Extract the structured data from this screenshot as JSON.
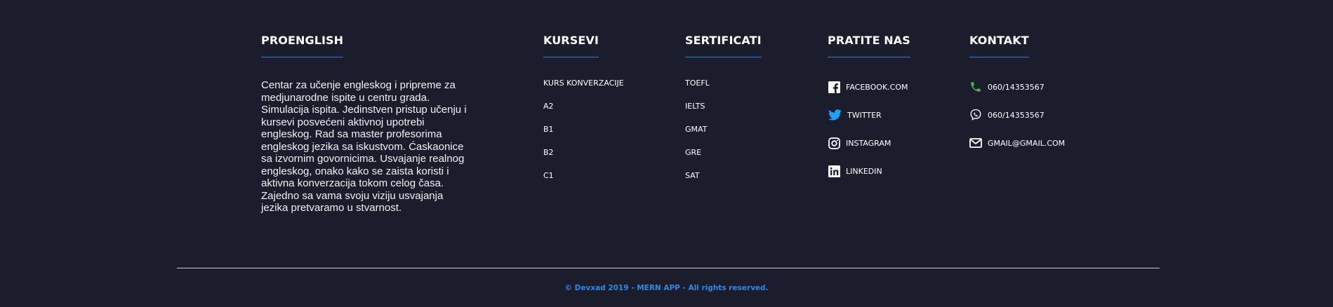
{
  "about": {
    "title": "PROENGLISH",
    "text": "Centar za učenje engleskog i pripreme za medjunarodne ispite u centru grada. Simulacija ispita. Jedinstven pristup učenju i kursevi posvećeni aktivnoj upotrebi engleskog. Rad sa master profesorima engleskog jezika sa iskustvom. Ćaskaonice sa izvornim govornicima. Usvajanje realnog engleskog, onako kako se zaista koristi i aktivna konverzacija tokom celog časa. Zajedno sa vama svoju viziju usvajanja jezika pretvaramo u stvarnost."
  },
  "courses": {
    "title": "KURSEVI",
    "items": [
      "KURS KONVERZACIJE",
      "A2",
      "B1",
      "B2",
      "C1"
    ]
  },
  "certificates": {
    "title": "SERTIFICATI",
    "items": [
      "TOEFL",
      "IELTS",
      "GMAT",
      "GRE",
      "SAT"
    ]
  },
  "follow": {
    "title": "PRATITE NAS",
    "items": [
      {
        "label": "FACEBOOK.COM",
        "icon": "facebook-icon"
      },
      {
        "label": "TWITTER",
        "icon": "twitter-icon"
      },
      {
        "label": "INSTAGRAM",
        "icon": "instagram-icon"
      },
      {
        "label": "LINKEDIN",
        "icon": "linkedin-icon"
      }
    ]
  },
  "contact": {
    "title": "KONTAKT",
    "items": [
      {
        "label": "060/14353567",
        "icon": "phone-icon"
      },
      {
        "label": "060/14353567",
        "icon": "viber-icon"
      },
      {
        "label": "GMAIL@GMAIL.COM",
        "icon": "envelope-icon"
      }
    ]
  },
  "footer": {
    "copyright": "© Devxad 2019 - MERN APP - All rights reserved."
  },
  "colors": {
    "background": "#1c1d2c",
    "accent": "#2f7fd8",
    "phone_green": "#4caf50",
    "twitter_blue": "#1da1f2"
  }
}
